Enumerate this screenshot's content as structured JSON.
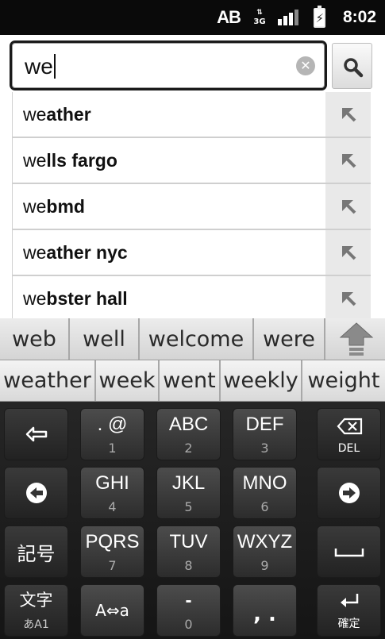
{
  "status_bar": {
    "carrier_badge": "AB",
    "network_type": "3G",
    "signal_icon": "signal-bars-icon",
    "battery_icon": "battery-charging-icon",
    "time": "8:02"
  },
  "search": {
    "query": "we",
    "clear_icon": "clear-icon",
    "search_icon": "search-icon"
  },
  "suggestions": [
    {
      "prefix": "we",
      "completion": "ather",
      "action_icon": "query-refine-arrow-icon"
    },
    {
      "prefix": "we",
      "completion": "lls fargo",
      "action_icon": "query-refine-arrow-icon"
    },
    {
      "prefix": "we",
      "completion": "bmd",
      "action_icon": "query-refine-arrow-icon"
    },
    {
      "prefix": "we",
      "completion": "ather nyc",
      "action_icon": "query-refine-arrow-icon"
    },
    {
      "prefix": "we",
      "completion": "bster hall",
      "action_icon": "query-refine-arrow-icon"
    }
  ],
  "candidates_row1": [
    "web",
    "well",
    "welcome",
    "were"
  ],
  "candidates_row2": [
    "weather",
    "week",
    "went",
    "weekly",
    "weight"
  ],
  "keyboard": {
    "row1": [
      {
        "icon": "undo-icon"
      },
      {
        "main": ". @",
        "sub": "1"
      },
      {
        "main": "ABC",
        "sub": "2"
      },
      {
        "main": "DEF",
        "sub": "3"
      },
      {
        "icon": "backspace-icon",
        "sub": "DEL"
      }
    ],
    "row2": [
      {
        "icon": "left-arrow-icon"
      },
      {
        "main": "GHI",
        "sub": "4"
      },
      {
        "main": "JKL",
        "sub": "5"
      },
      {
        "main": "MNO",
        "sub": "6"
      },
      {
        "icon": "right-arrow-icon"
      }
    ],
    "row3": [
      {
        "main": "記号"
      },
      {
        "main": "PQRS",
        "sub": "7"
      },
      {
        "main": "TUV",
        "sub": "8"
      },
      {
        "main": "WXYZ",
        "sub": "9"
      },
      {
        "icon": "space-icon"
      }
    ],
    "row4": [
      {
        "main": "文字",
        "sub": "あA1"
      },
      {
        "main": "A⇔a"
      },
      {
        "main": "-",
        "sub": "0"
      },
      {
        "main": ",  ."
      },
      {
        "icon": "enter-icon",
        "sub": "確定"
      }
    ]
  }
}
